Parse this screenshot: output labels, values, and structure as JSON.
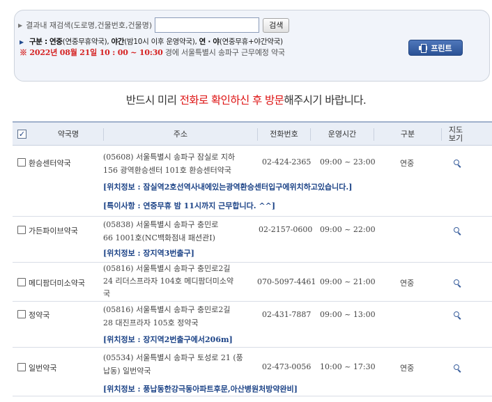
{
  "search": {
    "label": "결과내 재검색(도로명,건물번호,건물명)",
    "value": "",
    "placeholder": "",
    "button": "검색"
  },
  "legend": {
    "title": "구분 :",
    "year_round": "연중",
    "year_round_desc": "(연중무휴약국),",
    "night": "야간",
    "night_desc": "(밤10시 이후 운영약국),",
    "both": "연 · 야",
    "both_desc": "(연중무휴+야간약국)"
  },
  "datetime": {
    "prefix": "※ 2022년 08월 21일 10 : 00 ~ 10:30",
    "suffix": "경에  서울특별시  송파구   근무예정 약국"
  },
  "print_button": "프린트",
  "notice": {
    "part1": "반드시 미리 ",
    "highlight": "전화로 확인하신 후 방문",
    "part2": "해주시기 바랍니다."
  },
  "table": {
    "headers": {
      "name": "약국명",
      "address": "주소",
      "phone": "전화번호",
      "hours": "운영시간",
      "type": "구분",
      "map_line1": "지도",
      "map_line2": "보기"
    },
    "rows": [
      {
        "name": "환승센터약국",
        "addr1": "(05608) 서울특별시 송파구 잠실로 지하",
        "addr2": "156 광역환승센터 101호 환승센터약국",
        "addr3": "",
        "phone": "02-424-2365",
        "hours": "09:00 ~ 23:00",
        "type": "연중",
        "info1": "[위치정보 : 잠실역2호선역사내에있는광역환승센터입구에위치하고있습니다.]",
        "info2": "[특이사항 : 연중무휴 밤 11시까지 근무합니다. ^^]"
      },
      {
        "name": "가든파이브약국",
        "addr1": "(05838) 서울특별시 송파구 충민로",
        "addr2": "66 1001호(NC백화점내 패션관I)",
        "addr3": "",
        "phone": "02-2157-0600",
        "hours": "09:00 ~ 22:00",
        "type": "",
        "info1": "[위치정보 : 장지역3번출구]",
        "info2": ""
      },
      {
        "name": "메디팜더미소약국",
        "addr1": "(05816) 서울특별시 송파구 충민로2길",
        "addr2": "24 리더스프라자 104호 메디팜더미소약",
        "addr3": "국",
        "phone": "070-5097-4461",
        "hours": "09:00 ~ 21:00",
        "type": "연중",
        "info1": "",
        "info2": ""
      },
      {
        "name": "정약국",
        "addr1": "(05816) 서울특별시 송파구 충민로2길",
        "addr2": "28 대진프라자 105호 정약국",
        "addr3": "",
        "phone": "02-431-7887",
        "hours": "09:00 ~ 13:00",
        "type": "",
        "info1": "[위치정보 : 장지역2번출구에서206m]",
        "info2": ""
      },
      {
        "name": "일번약국",
        "addr1": "(05534) 서울특별시 송파구 토성로 21 (풍",
        "addr2": "납동) 일번약국",
        "addr3": "",
        "phone": "02-473-0056",
        "hours": "10:00 ~ 17:30",
        "type": "연중",
        "info1": "[위치정보 : 풍납동한강극동아파트후문,아산병원처방약완비]",
        "info2": ""
      }
    ]
  }
}
